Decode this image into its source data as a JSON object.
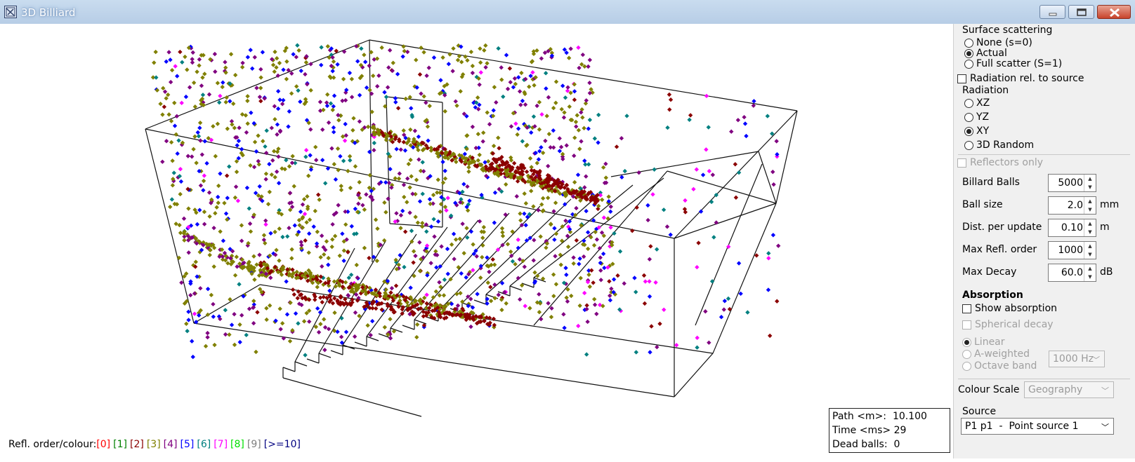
{
  "window": {
    "title": "3D Billiard"
  },
  "legend": {
    "prefix": "Refl. order/colour:",
    "items": [
      {
        "label": "[0]",
        "color": "#ff0000"
      },
      {
        "label": "[1]",
        "color": "#008000"
      },
      {
        "label": "[2]",
        "color": "#8b0000"
      },
      {
        "label": "[3]",
        "color": "#808000"
      },
      {
        "label": "[4]",
        "color": "#800080"
      },
      {
        "label": "[5]",
        "color": "#0000ff"
      },
      {
        "label": "[6]",
        "color": "#008080"
      },
      {
        "label": "[7]",
        "color": "#ff00ff"
      },
      {
        "label": "[8]",
        "color": "#00e000"
      },
      {
        "label": "[9]",
        "color": "#808080"
      },
      {
        "label": "[>=10]",
        "color": "#000080"
      }
    ]
  },
  "info": {
    "path_label": "Path <m>:",
    "path_value": "10.100",
    "time_label": "Time <ms>",
    "time_value": "29",
    "dead_label": "Dead balls:",
    "dead_value": "0"
  },
  "panel": {
    "surface_scattering": {
      "title": "Surface scattering",
      "options": [
        "None (s=0)",
        "Actual",
        "Full scatter (S=1)"
      ],
      "selected": "Actual"
    },
    "radiation_rel_to_source": "Radiation rel. to source",
    "radiation": {
      "title": "Radiation",
      "options": [
        "XZ",
        "YZ",
        "XY",
        "3D Random"
      ],
      "selected": "XY"
    },
    "reflectors_only": "Reflectors only",
    "fields": [
      {
        "label": "Billard Balls",
        "value": "5000",
        "unit": ""
      },
      {
        "label": "Ball size",
        "value": "2.0",
        "unit": "mm"
      },
      {
        "label": "Dist. per update",
        "value": "0.10",
        "unit": "m"
      },
      {
        "label": "Max Refl. order",
        "value": "1000",
        "unit": ""
      },
      {
        "label": "Max Decay",
        "value": "60.0",
        "unit": "dB"
      }
    ],
    "absorption": {
      "title": "Absorption",
      "show": "Show absorption",
      "spherical": "Spherical decay",
      "weighting": [
        "Linear",
        "A-weighted",
        "Octave band"
      ],
      "band": "1000 Hz"
    },
    "colour_scale": {
      "label": "Colour Scale",
      "value": "Geography"
    },
    "source": {
      "title": "Source",
      "value": "P1 p1  -  Point source 1"
    }
  }
}
